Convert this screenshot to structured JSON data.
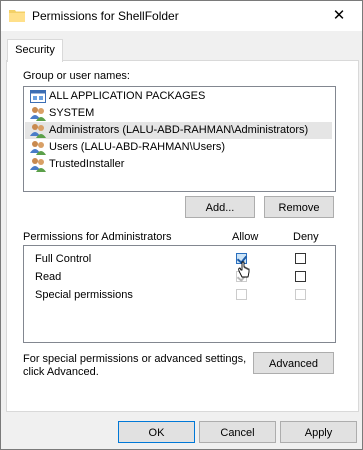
{
  "window": {
    "title": "Permissions for ShellFolder",
    "close_glyph": "✕"
  },
  "tabs": [
    {
      "label": "Security",
      "active": true
    }
  ],
  "group_section": {
    "label": "Group or user names:",
    "items": [
      {
        "name": "ALL APPLICATION PACKAGES",
        "icon": "app-package-icon",
        "selected": false
      },
      {
        "name": "SYSTEM",
        "icon": "users-icon",
        "selected": false
      },
      {
        "name": "Administrators (LALU-ABD-RAHMAN\\Administrators)",
        "icon": "users-icon",
        "selected": true
      },
      {
        "name": "Users (LALU-ABD-RAHMAN\\Users)",
        "icon": "users-icon",
        "selected": false
      },
      {
        "name": "TrustedInstaller",
        "icon": "users-icon",
        "selected": false
      }
    ],
    "add_label": "Add...",
    "remove_label": "Remove"
  },
  "permissions": {
    "label": "Permissions for Administrators",
    "allow_header": "Allow",
    "deny_header": "Deny",
    "rows": [
      {
        "name": "Full Control",
        "allow": true,
        "allow_enabled": true,
        "deny": false,
        "deny_enabled": true
      },
      {
        "name": "Read",
        "allow": true,
        "allow_enabled": false,
        "deny": false,
        "deny_enabled": true
      },
      {
        "name": "Special permissions",
        "allow": false,
        "allow_enabled": false,
        "deny": false,
        "deny_enabled": false
      }
    ]
  },
  "advanced": {
    "text_line1": "For special permissions or advanced settings,",
    "text_line2": "click Advanced.",
    "button_label": "Advanced"
  },
  "footer": {
    "ok_label": "OK",
    "cancel_label": "Cancel",
    "apply_label": "Apply"
  },
  "colors": {
    "accent": "#0078d7",
    "selection": "#e5e5e5",
    "dialog_bg": "#f0f0f0"
  }
}
